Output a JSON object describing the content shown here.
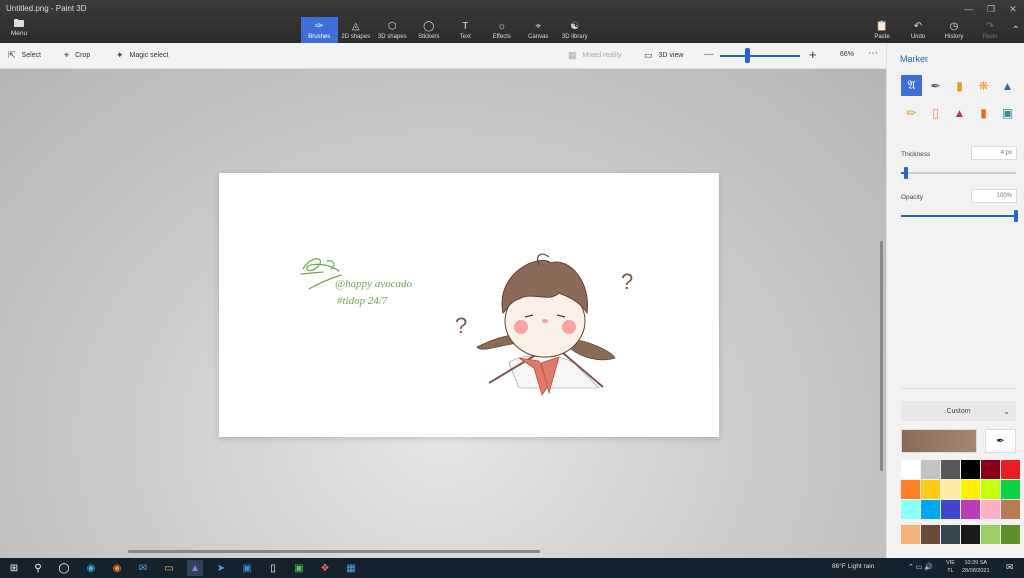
{
  "window": {
    "title": "Untitled.png - Paint 3D"
  },
  "menu": {
    "label": "Menu",
    "icon": "folder-icon"
  },
  "tools": [
    {
      "label": "Brushes",
      "icon": "brush-icon",
      "active": true
    },
    {
      "label": "2D shapes",
      "icon": "shapes-2d-icon"
    },
    {
      "label": "3D shapes",
      "icon": "cube-icon"
    },
    {
      "label": "Stickers",
      "icon": "sticker-icon"
    },
    {
      "label": "Text",
      "icon": "text-icon"
    },
    {
      "label": "Effects",
      "icon": "effects-icon"
    },
    {
      "label": "Canvas",
      "icon": "canvas-icon"
    },
    {
      "label": "3D library",
      "icon": "library-icon"
    }
  ],
  "right_tools": [
    {
      "label": "Paste",
      "icon": "paste-icon"
    },
    {
      "label": "Undo",
      "icon": "undo-icon"
    },
    {
      "label": "History",
      "icon": "history-icon"
    },
    {
      "label": "Redo",
      "icon": "redo-icon",
      "disabled": true
    }
  ],
  "subbar": {
    "select": "Select",
    "crop": "Crop",
    "magic_select": "Magic select",
    "mixed_reality": "Mixed reality",
    "view_3d": "3D view",
    "zoom": "66%",
    "zoom_level": 0.66
  },
  "drawing": {
    "handle": "@happy avocado",
    "tag": "#tidop 24/7",
    "question_mark": "?"
  },
  "panel": {
    "title": "Marker",
    "thickness_label": "Thickness",
    "thickness_value": "4 px",
    "thickness_level": 0.04,
    "opacity_label": "Opacity",
    "opacity_value": "100%",
    "opacity_level": 1.0,
    "color_mode": "Custom",
    "current_color": "#8b6a57",
    "palette": [
      "#ffffff",
      "#c3c3c3",
      "#585858",
      "#000000",
      "#88001b",
      "#ec1c24",
      "#ff7f27",
      "#ffca18",
      "#fdeca6",
      "#fff200",
      "#c4ff0e",
      "#0ed145",
      "#8cfffb",
      "#00a8f3",
      "#3f48cc",
      "#b83dba",
      "#ffaec8",
      "#b97a56"
    ],
    "custom_palette": [
      "#f7b27a",
      "#6b4a37",
      "#37474f",
      "#1b1b1b",
      "#9ccc65",
      "#5a8f29"
    ]
  },
  "taskbar": {
    "weather": "86°F  Light rain",
    "lang_top": "VIE",
    "lang_bottom": "TL",
    "time": "10:39 SA",
    "date": "28/08/2021"
  },
  "colors": {
    "accent": "#3d6fd6"
  }
}
